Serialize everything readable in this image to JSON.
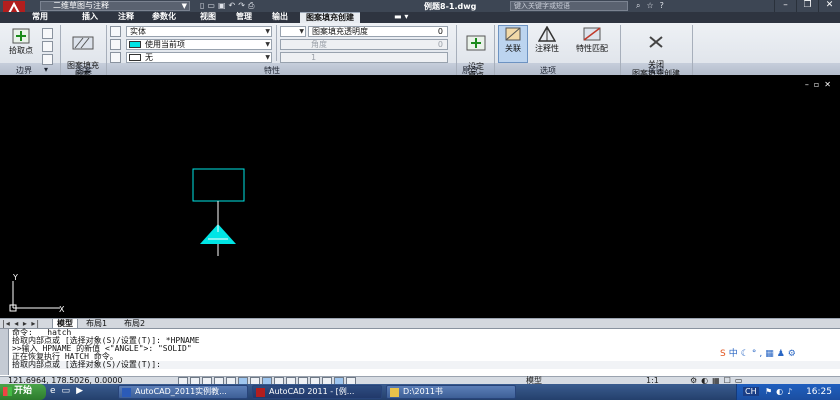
{
  "titlebar": {
    "workspace": "二维草图与注释",
    "document_title": "例题8-1.dwg",
    "search_placeholder": "键入关键字或短语"
  },
  "tabs": [
    {
      "label": "常用"
    },
    {
      "label": "插入"
    },
    {
      "label": "注释"
    },
    {
      "label": "参数化"
    },
    {
      "label": "视图"
    },
    {
      "label": "管理"
    },
    {
      "label": "输出"
    },
    {
      "label": "图案填充创建",
      "active": true
    }
  ],
  "ribbon": {
    "boundary": {
      "pick_points": "拾取点",
      "panel_title": "边界"
    },
    "pattern": {
      "button": "图案填充\n图案",
      "panel_title": "图案"
    },
    "properties": {
      "type_combo": "实体",
      "color_combo": "使用当前项",
      "bg_combo": "无",
      "transparency_label": "图案填充透明度",
      "transparency_value": "0",
      "angle_label": "角度",
      "angle_value": "0",
      "scale_value": "1",
      "panel_title": "特性"
    },
    "origin": {
      "set_origin": "设定\n原点",
      "panel_title": "原点"
    },
    "options": {
      "associative": "关联",
      "annotative": "注释性",
      "match_properties": "特性匹配",
      "panel_title": "选项"
    },
    "close": {
      "button": "关闭\n图案填充创建",
      "panel_title": "关闭"
    }
  },
  "layout_tabs": [
    {
      "label": "模型",
      "active": true
    },
    {
      "label": "布局1"
    },
    {
      "label": "布局2"
    }
  ],
  "command_lines": [
    "命令:  _hatch",
    "拾取内部点或 [选择对象(S)/设置(T)]: *HPNAME",
    ">>输入 HPNAME 的新值 <\"ANGLE\">: \"SOLID\"",
    "正在恢复执行 HATCH 命令。",
    "拾取内部点或 [选择对象(S)/设置(T)]:"
  ],
  "status": {
    "coords": "121.6964, 178.5026, 0.0000",
    "model_label": "模型",
    "scale": "1:1"
  },
  "taskbar": {
    "start": "开始",
    "tasks": [
      {
        "label": "AutoCAD_2011实例教..."
      },
      {
        "label": "AutoCAD 2011 - [例..."
      },
      {
        "label": "D:\\2011书"
      }
    ],
    "clock": "16:25"
  },
  "colors": {
    "drawing_bg": "#000000",
    "hatch_cyan": "#00e5e5",
    "titlebar": "#3d4654"
  }
}
